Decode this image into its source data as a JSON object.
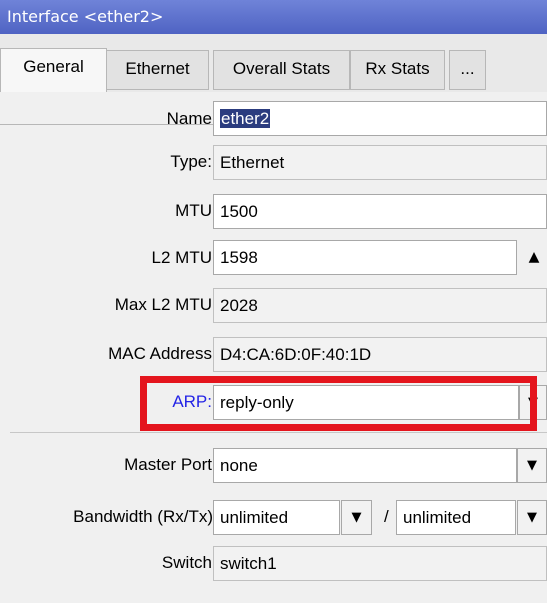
{
  "window": {
    "title": "Interface <ether2>"
  },
  "tabs": [
    {
      "label": "General",
      "active": true
    },
    {
      "label": "Ethernet",
      "active": false
    },
    {
      "label": "Overall Stats",
      "active": false
    },
    {
      "label": "Rx Stats",
      "active": false
    },
    {
      "label": "...",
      "active": false
    }
  ],
  "form": {
    "name": {
      "label": "Name",
      "value": "ether2"
    },
    "type": {
      "label": "Type:",
      "value": "Ethernet"
    },
    "mtu": {
      "label": "MTU",
      "value": "1500"
    },
    "l2mtu": {
      "label": "L2 MTU",
      "value": "1598"
    },
    "max_l2mtu": {
      "label": "Max L2 MTU",
      "value": "2028"
    },
    "mac": {
      "label": "MAC Address",
      "value": "D4:CA:6D:0F:40:1D"
    },
    "arp": {
      "label": "ARP:",
      "value": "reply-only"
    },
    "master_port": {
      "label": "Master Port",
      "value": "none"
    },
    "bandwidth": {
      "label": "Bandwidth (Rx/Tx)",
      "rx": "unlimited",
      "separator": "/",
      "tx": "unlimited"
    },
    "switch": {
      "label": "Switch",
      "value": "switch1"
    }
  },
  "colors": {
    "titlebar": "#5a6ecb",
    "highlight": "#e4151d",
    "label_link": "#2424e6"
  },
  "icons": {
    "dropdown": "dropdown-arrow-icon",
    "collapse": "triangle-up-icon"
  }
}
